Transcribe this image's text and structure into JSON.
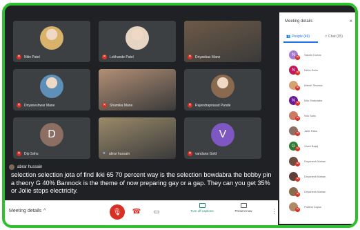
{
  "tiles": [
    {
      "name": "Nitin Patel",
      "kind": "photo",
      "color": "#d9b36a"
    },
    {
      "name": "Lokhande Patel",
      "kind": "photo",
      "color": "#e6d5c3"
    },
    {
      "name": "Dnyanbas Mane",
      "kind": "video",
      "color": "#6d5a47"
    },
    {
      "name": "Dnyaneshwar Mane",
      "kind": "photo",
      "color": "#5d8fb8"
    },
    {
      "name": "Shamika Mane",
      "kind": "video",
      "color": "#b28f75"
    },
    {
      "name": "Rajendraprasad Pande",
      "kind": "photo",
      "color": "#8a6a4e"
    },
    {
      "name": "Dip Sahu",
      "kind": "letter",
      "letter": "D",
      "color": "#8d6e63"
    },
    {
      "name": "abrar hussain",
      "kind": "video",
      "color": "#9a8a6a",
      "pinned": true
    },
    {
      "name": "vandana Gold",
      "kind": "letter",
      "letter": "V",
      "color": "#7e57c2"
    }
  ],
  "caption": {
    "speaker": "abrar hussain",
    "text": "selection selection jota of find ikki 65 70 percent way is the selection bowdabra the bobby pin a theory G 40% Bannock is the theme of now preparing gay or a gap. They can you get 35% or Jolie stops electricity."
  },
  "controls": {
    "meeting_details": "Meeting details",
    "chevron": "^",
    "mic_glyph": "🎙",
    "hangup_glyph": "☎",
    "camera_glyph": "▭",
    "captions_label": "Turn off captions",
    "present_label": "Present now",
    "more_glyph": "⋮"
  },
  "panel": {
    "title": "Meeting details",
    "close": "×",
    "tab_people": "People (49)",
    "tab_chat": "Chat (35)",
    "people": [
      {
        "name": "Sakshi Kumar",
        "initial": "N",
        "color": "#a67bd4"
      },
      {
        "name": "Neha Sahu",
        "initial": "N",
        "color": "#c2185b"
      },
      {
        "name": "Nitesh Sharma",
        "initial": "",
        "color": "#d4a373"
      },
      {
        "name": "Nilu Shahdalia",
        "initial": "N",
        "color": "#6a1b9a"
      },
      {
        "name": "Nilu Sahu",
        "initial": "",
        "color": "#c97b63"
      },
      {
        "name": "Jahir Rasu",
        "initial": "",
        "color": "#8d6e63"
      },
      {
        "name": "Vivek Bajaj",
        "initial": "G",
        "color": "#2e7d32"
      },
      {
        "name": "Dnyanesh Mahan",
        "initial": "",
        "color": "#6d4c41"
      },
      {
        "name": "Dnyanesh Mahan",
        "initial": "",
        "color": "#5d4037"
      },
      {
        "name": "Dnyanesh Mahan",
        "initial": "",
        "color": "#8a6a4e"
      },
      {
        "name": "Pratiba Gupta",
        "initial": "",
        "color": "#b08968"
      }
    ]
  },
  "colors": {
    "frame_green": "#2ec02e",
    "stage_bg": "#202124",
    "mute_red": "#d93025",
    "accent_blue": "#1a73e8",
    "captions_green": "#1a8e6c"
  }
}
